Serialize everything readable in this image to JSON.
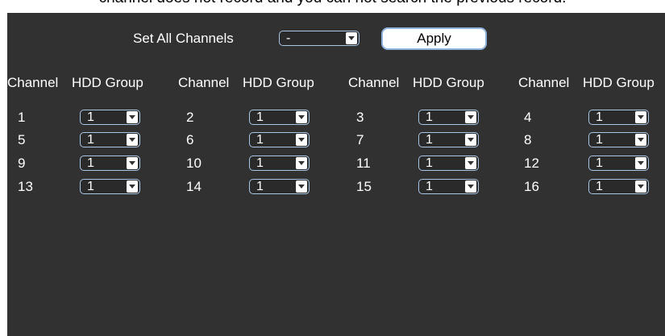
{
  "header_note": "channel does not record and you can not search the previous record.",
  "set_all": {
    "label": "Set All Channels",
    "value": "-"
  },
  "apply_label": "Apply",
  "column_headers": [
    {
      "channel": "Channel",
      "group": "HDD Group"
    },
    {
      "channel": "Channel",
      "group": "HDD Group"
    },
    {
      "channel": "Channel",
      "group": "HDD Group"
    },
    {
      "channel": "Channel",
      "group": "HDD Group"
    }
  ],
  "channels": [
    {
      "number": "1",
      "group": "1"
    },
    {
      "number": "2",
      "group": "1"
    },
    {
      "number": "3",
      "group": "1"
    },
    {
      "number": "4",
      "group": "1"
    },
    {
      "number": "5",
      "group": "1"
    },
    {
      "number": "6",
      "group": "1"
    },
    {
      "number": "7",
      "group": "1"
    },
    {
      "number": "8",
      "group": "1"
    },
    {
      "number": "9",
      "group": "1"
    },
    {
      "number": "10",
      "group": "1"
    },
    {
      "number": "11",
      "group": "1"
    },
    {
      "number": "12",
      "group": "1"
    },
    {
      "number": "13",
      "group": "1"
    },
    {
      "number": "14",
      "group": "1"
    },
    {
      "number": "15",
      "group": "1"
    },
    {
      "number": "16",
      "group": "1"
    }
  ]
}
